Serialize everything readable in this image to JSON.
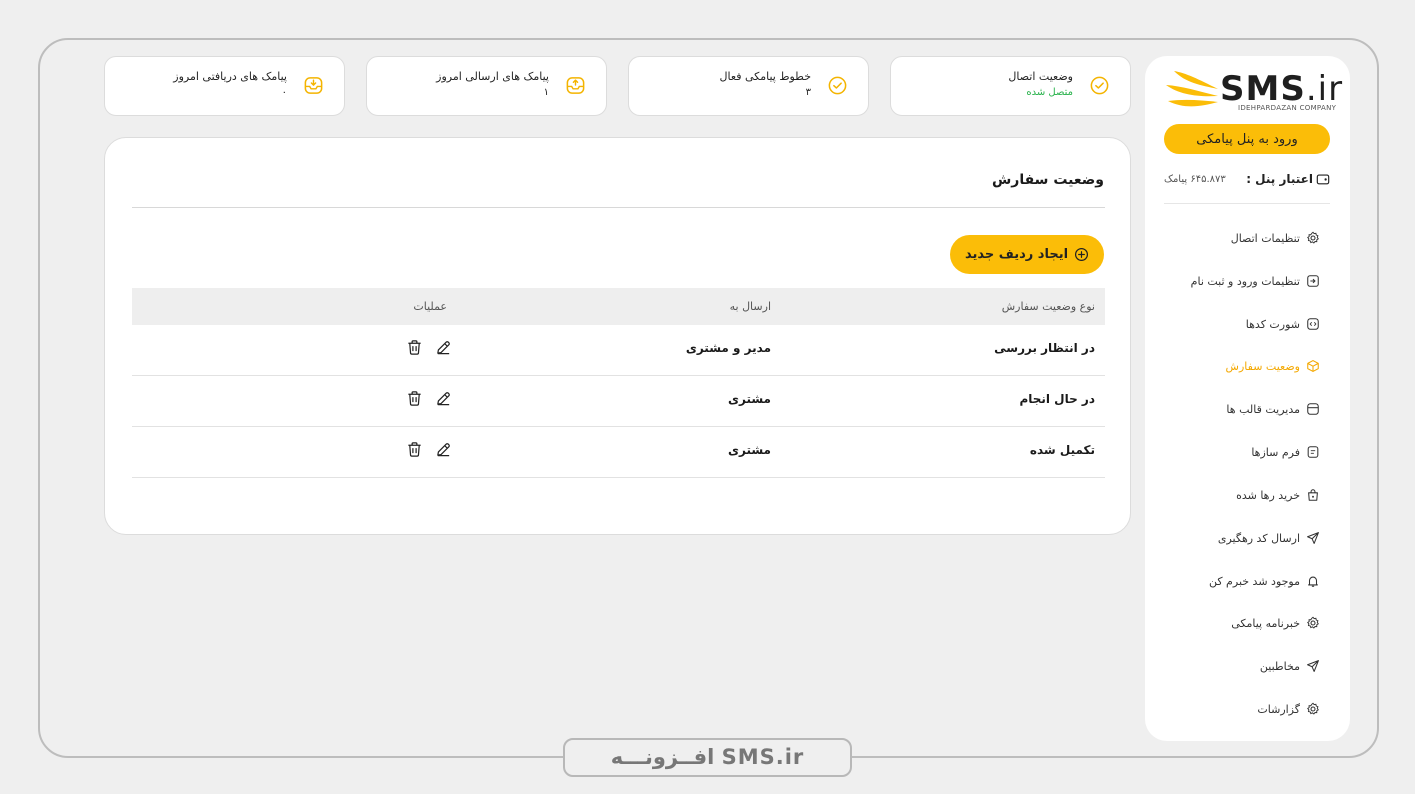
{
  "brand": {
    "name": "SMS",
    "name_suffix": ".ir",
    "company": "IDEHPARDAZAN COMPANY"
  },
  "sidebar": {
    "login_button": "ورود به پنل پیامکی",
    "credit_label": "اعتبار پنل :",
    "credit_value": "۶۴۵.۸۷۳ پیامک",
    "items": [
      {
        "label": "تنظیمات اتصال",
        "icon": "gear-icon"
      },
      {
        "label": "تنظیمات ورود و ثبت نام",
        "icon": "login-icon"
      },
      {
        "label": "شورت کدها",
        "icon": "code-icon"
      },
      {
        "label": "وضعیت سفارش",
        "icon": "box-icon",
        "active": true
      },
      {
        "label": "مدیریت قالب ها",
        "icon": "template-icon"
      },
      {
        "label": "فرم سازها",
        "icon": "form-icon"
      },
      {
        "label": "خرید رها شده",
        "icon": "bag-icon"
      },
      {
        "label": "ارسال کد رهگیری",
        "icon": "send-icon"
      },
      {
        "label": "موجود شد خبرم کن",
        "icon": "bell-icon"
      },
      {
        "label": "خبرنامه پیامکی",
        "icon": "gear-icon"
      },
      {
        "label": "مخاطبین",
        "icon": "send-icon"
      },
      {
        "label": "گزارشات",
        "icon": "gear-icon"
      }
    ]
  },
  "stats": [
    {
      "title": "وضعیت اتصال",
      "value": "متصل شده",
      "icon": "check-circle-icon"
    },
    {
      "title": "خطوط پیامکی فعال",
      "value": "۳",
      "icon": "check-circle-icon"
    },
    {
      "title": "پیامک های ارسالی امروز",
      "value": "۱",
      "icon": "inbox-upload-icon"
    },
    {
      "title": "پیامک های دریافتی امروز",
      "value": "۰",
      "icon": "inbox-download-icon"
    }
  ],
  "main": {
    "title": "وضعیت سفارش",
    "new_button": "ایجاد ردیف جدید",
    "headers": [
      "نوع وضعیت سفارش",
      "ارسال به",
      "عملیات"
    ],
    "rows": [
      {
        "status": "در انتظار بررسی",
        "send_to": "مدیر و مشتری"
      },
      {
        "status": "در حال انجام",
        "send_to": "مشتری"
      },
      {
        "status": "تکمیل شده",
        "send_to": "مشتری"
      }
    ]
  },
  "caption": "افــزونـــه SMS.ir",
  "colors": {
    "accent": "#fbbd08",
    "active": "#f4a800",
    "success": "#28b24b",
    "background": "#efefef"
  }
}
